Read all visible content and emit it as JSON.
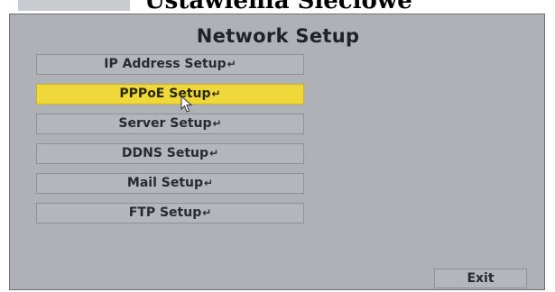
{
  "document": {
    "heading": "Ustawienia Sieciowe"
  },
  "osd": {
    "title": "Network Setup",
    "enter_glyph": "↵",
    "menu_items": [
      {
        "label": "IP Address Setup",
        "selected": false
      },
      {
        "label": "PPPoE Setup",
        "selected": true
      },
      {
        "label": "Server Setup",
        "selected": false
      },
      {
        "label": "DDNS Setup",
        "selected": false
      },
      {
        "label": "Mail Setup",
        "selected": false
      },
      {
        "label": "FTP Setup",
        "selected": false
      }
    ],
    "exit_label": "Exit"
  },
  "colors": {
    "panel": "#aeb2b6",
    "button": "#b3b7bb",
    "selected": "#f0d83a",
    "text": "#272b30"
  },
  "icons": {
    "enter": "enter-return-icon",
    "cursor": "mouse-pointer-icon"
  }
}
